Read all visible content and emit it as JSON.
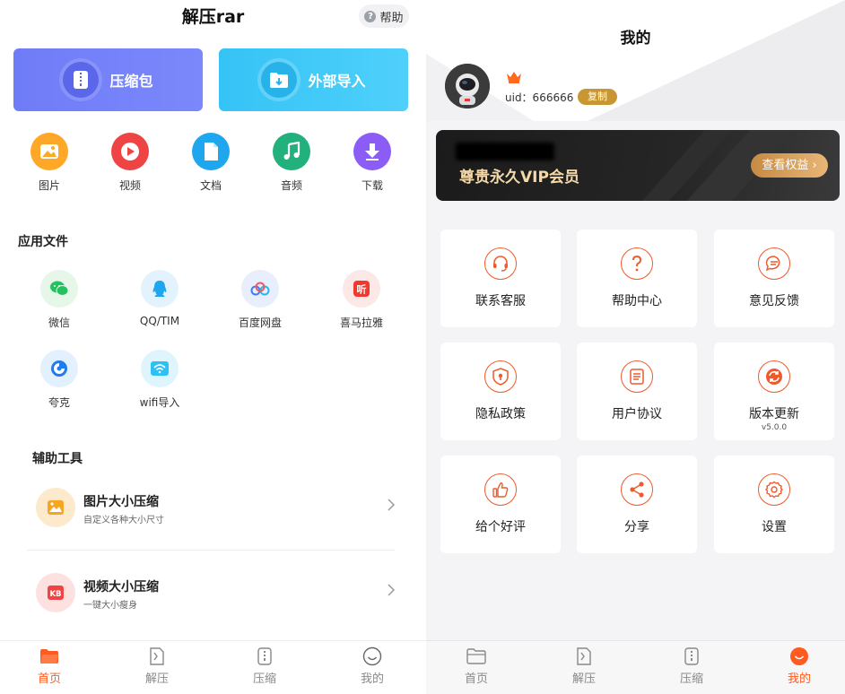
{
  "left": {
    "title": "解压rar",
    "help_label": "帮助",
    "big_cards": {
      "compress_label": "压缩包",
      "import_label": "外部导入"
    },
    "categories": [
      {
        "label": "图片",
        "color": "#ffa726",
        "icon": "image-icon"
      },
      {
        "label": "视频",
        "color": "#ef4444",
        "icon": "play-icon"
      },
      {
        "label": "文档",
        "color": "#1ea7ef",
        "icon": "document-icon"
      },
      {
        "label": "音频",
        "color": "#22b07d",
        "icon": "music-icon"
      },
      {
        "label": "下载",
        "color": "#8b5cf6",
        "icon": "download-icon"
      }
    ],
    "app_files_title": "应用文件",
    "apps": [
      {
        "label": "微信",
        "icon": "wechat-icon"
      },
      {
        "label": "QQ/TIM",
        "icon": "qq-icon"
      },
      {
        "label": "百度网盘",
        "icon": "baidu-netdisk-icon"
      },
      {
        "label": "喜马拉雅",
        "icon": "ximalaya-icon"
      },
      {
        "label": "夸克",
        "icon": "quark-icon"
      },
      {
        "label": "wifi导入",
        "icon": "wifi-icon"
      }
    ],
    "tools_title": "辅助工具",
    "tools": [
      {
        "name": "图片大小压缩",
        "desc": "自定义各种大小尺寸",
        "icon": "image-compress-icon"
      },
      {
        "name": "视频大小压缩",
        "desc": "一键大小瘦身",
        "icon": "video-compress-icon"
      }
    ],
    "tabs": [
      {
        "label": "首页",
        "active": true,
        "icon": "folder-icon"
      },
      {
        "label": "解压",
        "active": false,
        "icon": "unzip-icon"
      },
      {
        "label": "压缩",
        "active": false,
        "icon": "zip-icon"
      },
      {
        "label": "我的",
        "active": false,
        "icon": "smile-icon"
      }
    ]
  },
  "right": {
    "title": "我的",
    "uid_text": "uid：666666",
    "copy_label": "复制",
    "vip_text": "尊贵永久VIP会员",
    "vip_button": "查看权益",
    "grid": [
      {
        "label": "联系客服",
        "sub": "",
        "icon": "headset-icon"
      },
      {
        "label": "帮助中心",
        "sub": "",
        "icon": "question-icon"
      },
      {
        "label": "意见反馈",
        "sub": "",
        "icon": "chat-icon"
      },
      {
        "label": "隐私政策",
        "sub": "",
        "icon": "shield-icon"
      },
      {
        "label": "用户协议",
        "sub": "",
        "icon": "document-icon"
      },
      {
        "label": "版本更新",
        "sub": "v5.0.0",
        "icon": "refresh-icon"
      },
      {
        "label": "给个好评",
        "sub": "",
        "icon": "thumbs-up-icon"
      },
      {
        "label": "分享",
        "sub": "",
        "icon": "share-icon"
      },
      {
        "label": "设置",
        "sub": "",
        "icon": "gear-icon"
      }
    ],
    "tabs": [
      {
        "label": "首页",
        "active": false,
        "icon": "folder-icon"
      },
      {
        "label": "解压",
        "active": false,
        "icon": "unzip-icon"
      },
      {
        "label": "压缩",
        "active": false,
        "icon": "zip-icon"
      },
      {
        "label": "我的",
        "active": true,
        "icon": "smile-icon"
      }
    ]
  },
  "colors": {
    "accent": "#ff5a1f",
    "icon_orange": "#ee5a2c",
    "gold": "#c99731"
  }
}
